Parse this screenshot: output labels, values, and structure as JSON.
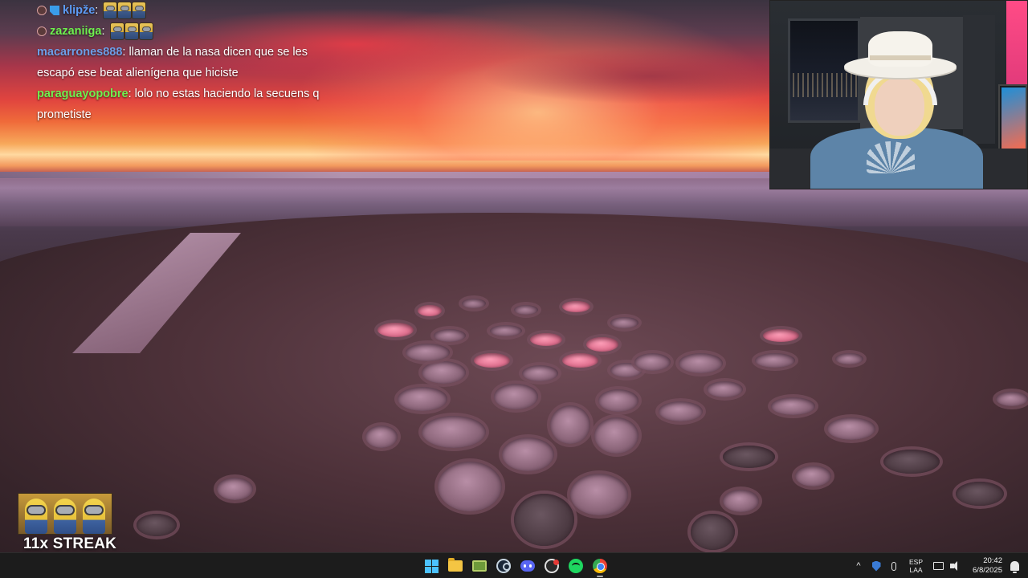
{
  "chat": {
    "messages": [
      {
        "user": "klipže",
        "separator": ":",
        "text": "",
        "badge": "dot+blue",
        "emotes": 3
      },
      {
        "user": "zazaniiga",
        "separator": ":",
        "text": "",
        "badge": "dot",
        "emotes": 3
      },
      {
        "user": "macarrones888",
        "separator": ":",
        "text": " llaman de la nasa dicen que se les escapó ese beat alienígena que hiciste"
      },
      {
        "user": "paraguayopobre",
        "separator": ":",
        "text": " lolo no estas haciendo la secuens q prometiste"
      }
    ],
    "colors": {
      "klipže": "#5d9cf5",
      "zazaniiga": "#6ff04f",
      "macarrones888": "#6d9fe8",
      "paraguayopobre": "#6ff04f"
    }
  },
  "streak": {
    "label": "11x STREAK"
  },
  "taskbar": {
    "apps": [
      {
        "name": "start-icon"
      },
      {
        "name": "file-explorer-icon"
      },
      {
        "name": "game-launcher-icon"
      },
      {
        "name": "steam-icon"
      },
      {
        "name": "discord-icon"
      },
      {
        "name": "obs-icon"
      },
      {
        "name": "spotify-icon"
      },
      {
        "name": "chrome-icon",
        "active": true
      }
    ],
    "tray": {
      "chevron": "^",
      "lang_top": "ESP",
      "lang_bottom": "LAA",
      "time": "20:42",
      "date": "6/8/2025"
    }
  }
}
